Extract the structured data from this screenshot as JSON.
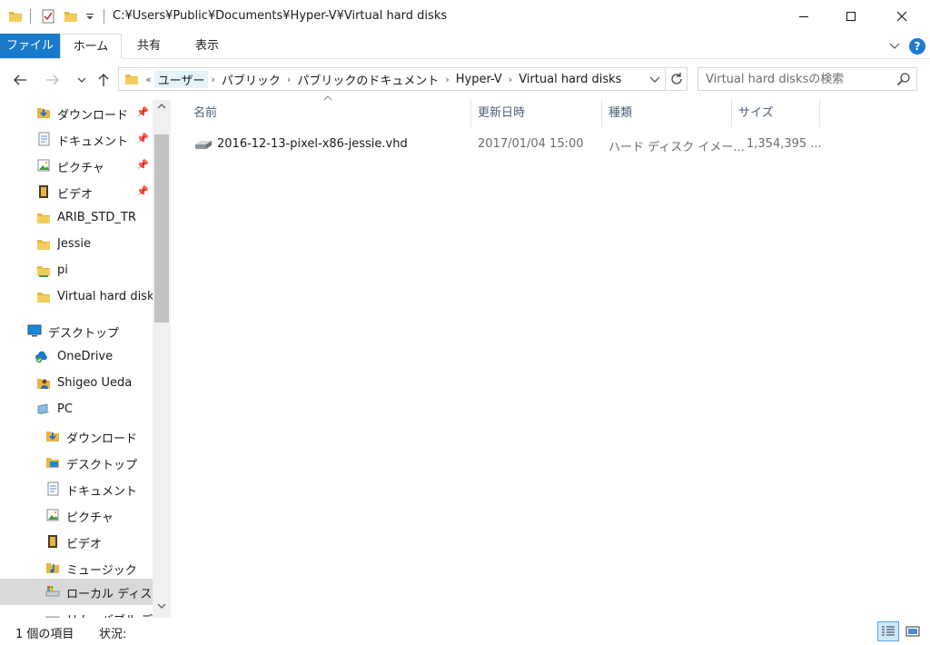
{
  "window": {
    "title": "C:¥Users¥Public¥Documents¥Hyper-V¥Virtual hard disks",
    "controls": [
      "minimize",
      "maximize",
      "close"
    ]
  },
  "ribbon": {
    "tabs": [
      {
        "label": "ファイル"
      },
      {
        "label": "ホーム"
      },
      {
        "label": "共有"
      },
      {
        "label": "表示"
      }
    ],
    "help_label": "?"
  },
  "address": {
    "overflow": "«",
    "crumbs": [
      "ユーザー",
      "パブリック",
      "パブリックのドキュメント",
      "Hyper-V",
      "Virtual hard disks"
    ]
  },
  "search": {
    "placeholder": "Virtual hard disksの検索"
  },
  "nav": {
    "items": [
      {
        "label": "ダウンロード",
        "icon": "download-folder-icon",
        "pinned": true
      },
      {
        "label": "ドキュメント",
        "icon": "documents-folder-icon",
        "pinned": true
      },
      {
        "label": "ピクチャ",
        "icon": "pictures-folder-icon",
        "pinned": true
      },
      {
        "label": "ビデオ",
        "icon": "videos-folder-icon",
        "pinned": true
      },
      {
        "label": "ARIB_STD_TR",
        "icon": "folder-icon",
        "pinned": false
      },
      {
        "label": "Jessie",
        "icon": "folder-icon",
        "pinned": false
      },
      {
        "label": "pi",
        "icon": "shared-folder-icon",
        "pinned": false
      },
      {
        "label": "Virtual hard disks",
        "icon": "folder-icon",
        "pinned": false
      },
      {
        "label": "デスクトップ",
        "icon": "desktop-icon",
        "pinned": false
      },
      {
        "label": "OneDrive",
        "icon": "onedrive-icon",
        "pinned": false
      },
      {
        "label": "Shigeo Ueda",
        "icon": "user-icon",
        "pinned": false
      },
      {
        "label": "PC",
        "icon": "pc-icon",
        "pinned": false
      },
      {
        "label": "ダウンロード",
        "icon": "download-folder-icon",
        "pinned": false
      },
      {
        "label": "デスクトップ",
        "icon": "desktop-folder-icon",
        "pinned": false
      },
      {
        "label": "ドキュメント",
        "icon": "documents-folder-icon",
        "pinned": false
      },
      {
        "label": "ピクチャ",
        "icon": "pictures-folder-icon",
        "pinned": false
      },
      {
        "label": "ビデオ",
        "icon": "videos-folder-icon",
        "pinned": false
      },
      {
        "label": "ミュージック",
        "icon": "music-folder-icon",
        "pinned": false
      },
      {
        "label": "ローカル ディスク (",
        "icon": "local-disk-icon",
        "pinned": false,
        "selected": true
      },
      {
        "label": "リムーバブル ディス",
        "icon": "removable-disk-icon",
        "pinned": false
      }
    ]
  },
  "columns": [
    "名前",
    "更新日時",
    "種類",
    "サイズ"
  ],
  "files": [
    {
      "name": "2016-12-13-pixel-x86-jessie.vhd",
      "date": "2017/01/04 15:00",
      "type": "ハード ディスク イメー...",
      "size": "1,354,395 ...",
      "icon": "vhd-file-icon"
    }
  ],
  "status": {
    "count": "1 個の項目",
    "state": "状況:"
  },
  "colors": {
    "file_tab": "#1979ca",
    "help": "#1c7ad4",
    "column_header_text": "#4c607a",
    "selection": "#d9d9d9",
    "folder": "#e8b640"
  }
}
